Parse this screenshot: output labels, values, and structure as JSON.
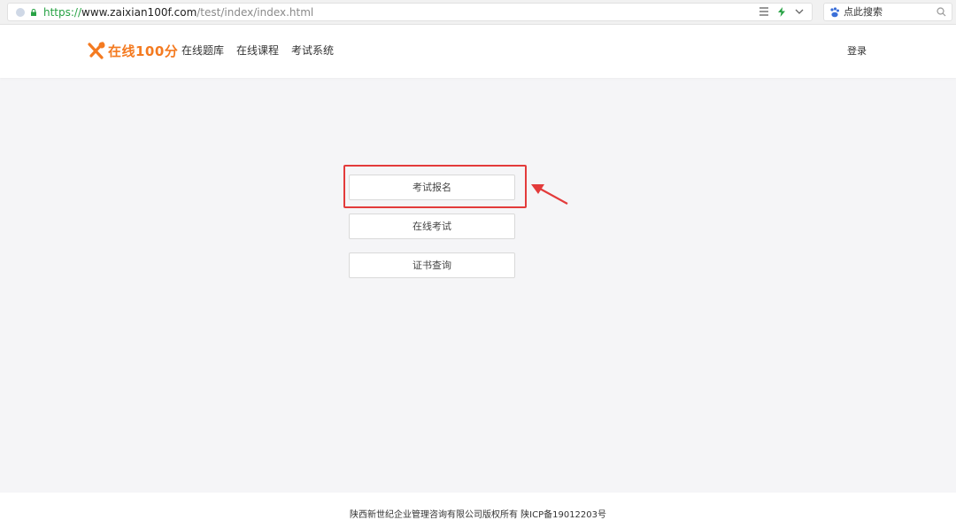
{
  "browser": {
    "url_scheme": "https://",
    "url_host": "www.zaixian100f.com",
    "url_path": "/test/index/index.html",
    "search_placeholder": "点此搜索"
  },
  "header": {
    "logo_text": "在线100分",
    "nav": [
      "在线题库",
      "在线课程",
      "考试系统"
    ],
    "login_label": "登录"
  },
  "main": {
    "buttons": [
      "考试报名",
      "在线考试",
      "证书查询"
    ],
    "highlight_color": "#e33b3b"
  },
  "footer": {
    "text": "陕西新世纪企业管理咨询有限公司版权所有 陕ICP备19012203号"
  },
  "colors": {
    "brand": "#f47a20",
    "url_scheme": "#27a244"
  }
}
